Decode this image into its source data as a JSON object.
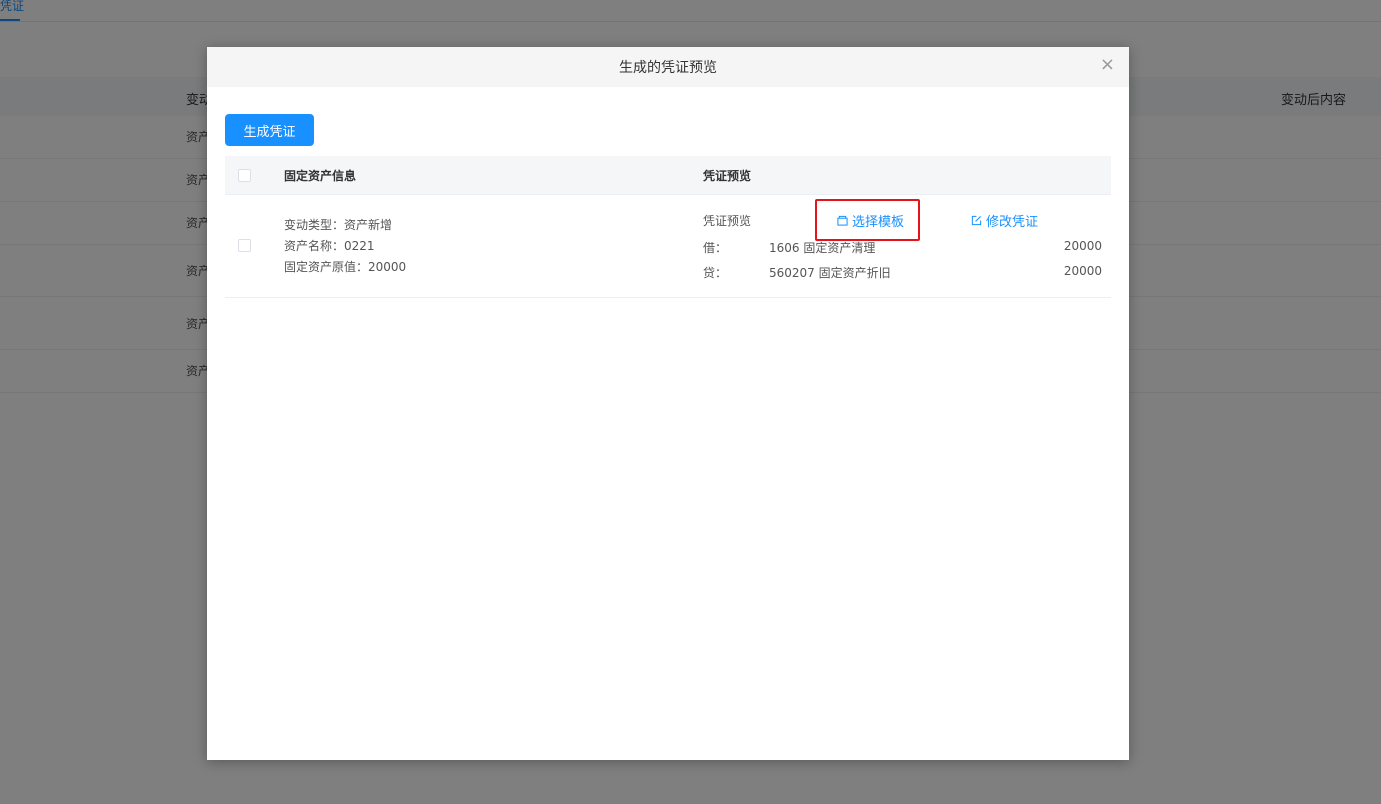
{
  "background": {
    "tab_label": "凭证",
    "table_headers": [
      "变动",
      "变动后内容"
    ],
    "rows": [
      "资产",
      "资产",
      "资产",
      "资产",
      "资产",
      "资产"
    ]
  },
  "dialog": {
    "title": "生成的凭证预览",
    "close_icon": "close-icon",
    "generate_button": "生成凭证",
    "table": {
      "headers": [
        "固定资产信息",
        "凭证预览"
      ],
      "row": {
        "info": [
          "变动类型：资产新增",
          "资产名称：0221",
          "固定资产原值：20000"
        ],
        "preview_label": "凭证预览",
        "select_template": "选择模板",
        "modify_voucher": "修改凭证",
        "entries": [
          {
            "direction": "借：",
            "account": "1606 固定资产清理",
            "amount": "20000"
          },
          {
            "direction": "贷：",
            "account": "560207 固定资产折旧",
            "amount": "20000"
          }
        ]
      }
    }
  },
  "colors": {
    "primary": "#1890ff",
    "highlight": "#e5141a",
    "mask": "rgba(0,0,0,0.5)"
  }
}
